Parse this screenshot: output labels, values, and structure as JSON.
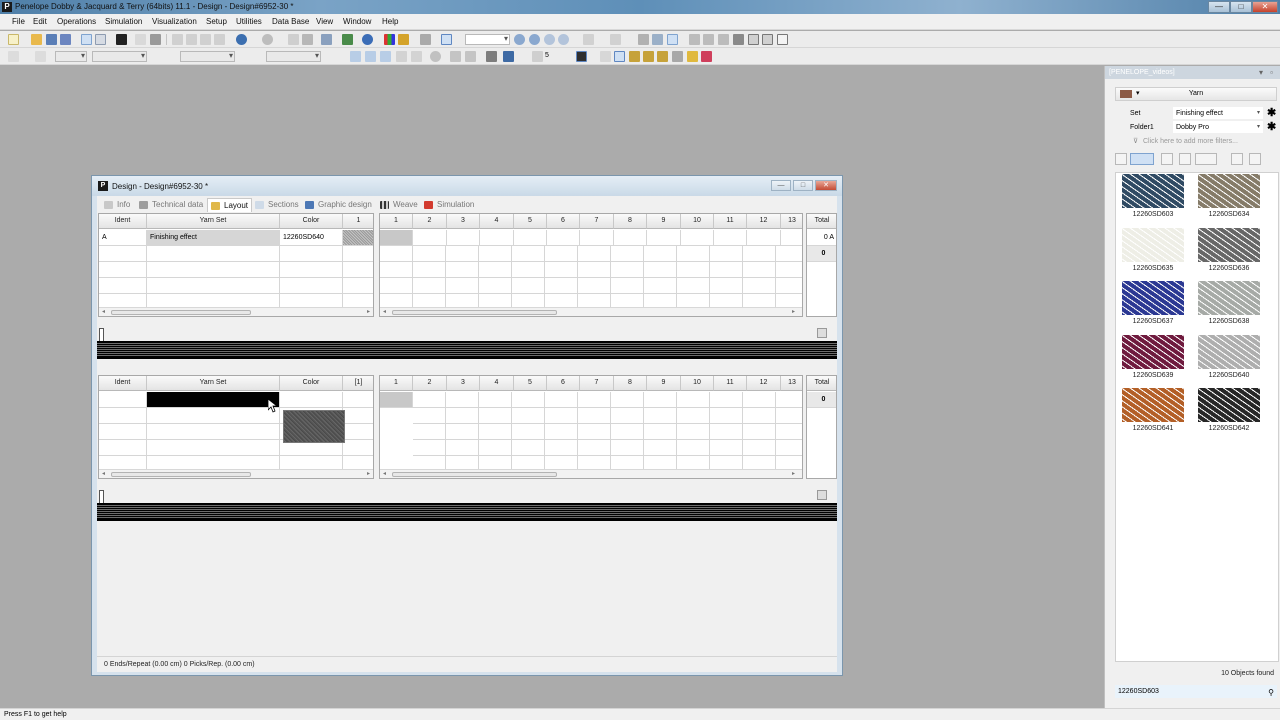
{
  "window": {
    "title": "Penelope Dobby & Jacquard & Terry (64bits) 11.1 - Design - Design#6952-30 *",
    "app_icon_letter": "P",
    "minimize": "—",
    "maximize": "□",
    "close": "✕"
  },
  "menu": [
    "File",
    "Edit",
    "Operations",
    "Simulation",
    "Visualization",
    "Setup",
    "Utilities",
    "Data Base",
    "View",
    "Window",
    "Help"
  ],
  "toolbar2": {
    "number_value": "5"
  },
  "design_window": {
    "title": "Design - Design#6952-30 *",
    "tabs": [
      {
        "label": "Info",
        "active": false
      },
      {
        "label": "Technical data",
        "active": false
      },
      {
        "label": "Layout",
        "active": true
      },
      {
        "label": "Sections",
        "active": false
      },
      {
        "label": "Graphic design",
        "active": false
      },
      {
        "label": "Weave",
        "active": false
      },
      {
        "label": "Simulation",
        "active": false
      }
    ],
    "warp_table": {
      "headers": {
        "ident": "Ident",
        "yarn_set": "Yarn Set",
        "color": "Color",
        "col1": "1"
      },
      "rows": [
        {
          "ident": "A",
          "yarn_set": "Finishing effect",
          "color": "12260SD640"
        }
      ],
      "repeat_headers": [
        "1",
        "2",
        "3",
        "4",
        "5",
        "6",
        "7",
        "8",
        "9",
        "10",
        "11",
        "12",
        "13"
      ],
      "total_header": "Total",
      "total_values": [
        "0 A",
        "0"
      ]
    },
    "weft_table": {
      "headers": {
        "ident": "Ident",
        "yarn_set": "Yarn Set",
        "color": "Color",
        "col1": "[1]"
      },
      "repeat_headers": [
        "1",
        "2",
        "3",
        "4",
        "5",
        "6",
        "7",
        "8",
        "9",
        "10",
        "11",
        "12",
        "13"
      ],
      "total_header": "Total",
      "total_values": [
        "0"
      ]
    },
    "status": "0 Ends/Repeat (0.00 cm)  0 Picks/Rep. (0.00 cm)"
  },
  "library": {
    "caption": "[PENELOPE_videos]",
    "type": "Yarn",
    "filters": [
      {
        "label": "Set",
        "value": "Finishing effect"
      },
      {
        "label": "Folder1",
        "value": "Dobby Pro"
      }
    ],
    "add_filter_hint": "Click here to add more filters...",
    "items": [
      {
        "code": "12260SD603",
        "color": "#2f4a63"
      },
      {
        "code": "12260SD634",
        "color": "#857b68"
      },
      {
        "code": "12260SD635",
        "color": "#eeeee6"
      },
      {
        "code": "12260SD636",
        "color": "#676767"
      },
      {
        "code": "12260SD637",
        "color": "#2b3893"
      },
      {
        "code": "12260SD638",
        "color": "#a6aaa6"
      },
      {
        "code": "12260SD639",
        "color": "#6f1a3e"
      },
      {
        "code": "12260SD640",
        "color": "#aeaeae"
      },
      {
        "code": "12260SD641",
        "color": "#b35f26"
      },
      {
        "code": "12260SD642",
        "color": "#262626"
      }
    ],
    "count": "10 Objects found",
    "selected": "12260SD603"
  },
  "statusbar": "Press F1 to get help"
}
